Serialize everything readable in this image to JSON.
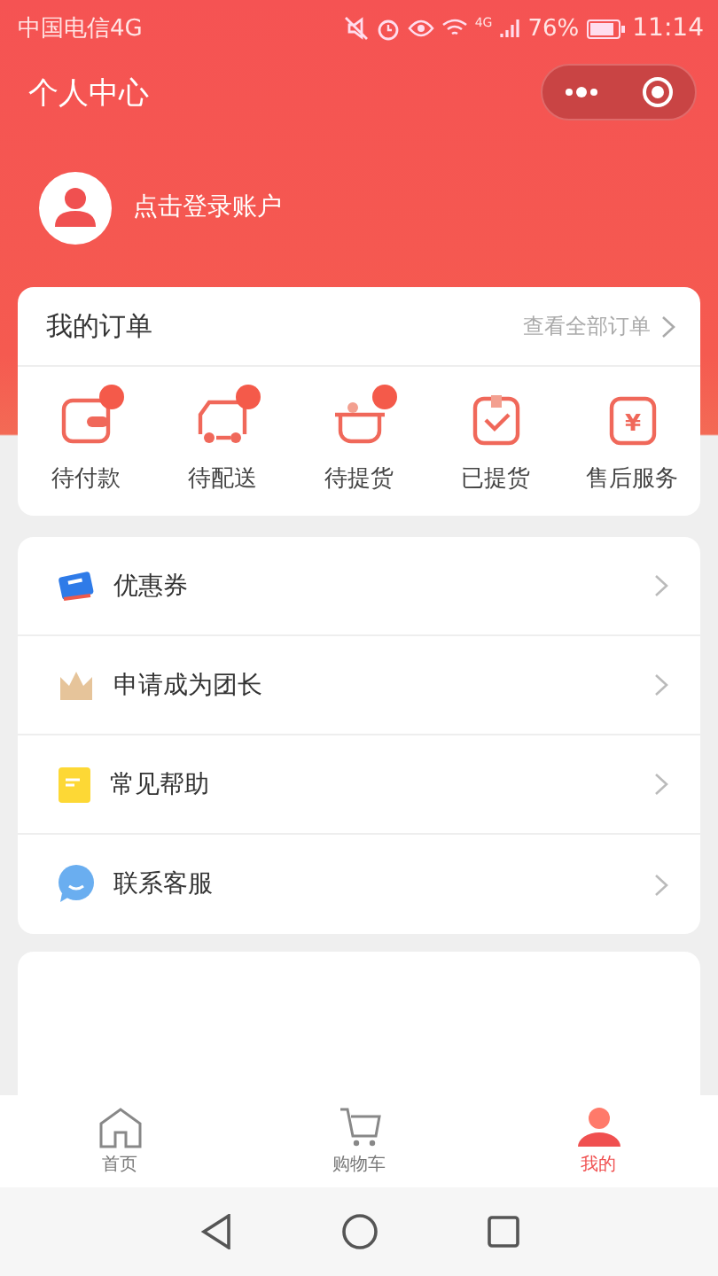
{
  "status_bar": {
    "carrier": "中国电信4G",
    "network": "4G",
    "battery": "76%",
    "time": "11:14"
  },
  "title_bar": {
    "title": "个人中心"
  },
  "profile": {
    "login_label": "点击登录账户"
  },
  "orders": {
    "title": "我的订单",
    "view_all": "查看全部订单",
    "items": [
      {
        "label": "待付款",
        "kind": "wallet",
        "badge": true
      },
      {
        "label": "待配送",
        "kind": "truck",
        "badge": true
      },
      {
        "label": "待提货",
        "kind": "basket",
        "badge": true
      },
      {
        "label": "已提货",
        "kind": "check",
        "badge": false
      },
      {
        "label": "售后服务",
        "kind": "refund",
        "badge": false,
        "icon_text": "¥"
      }
    ]
  },
  "menu": [
    {
      "label": "优惠券",
      "kind": "coupon"
    },
    {
      "label": "申请成为团长",
      "kind": "crown"
    },
    {
      "label": "常见帮助",
      "kind": "note"
    },
    {
      "label": "联系客服",
      "kind": "chat"
    }
  ],
  "tab_bar": [
    {
      "label": "首页",
      "kind": "home",
      "selected": false
    },
    {
      "label": "购物车",
      "kind": "cart",
      "selected": false
    },
    {
      "label": "我的",
      "kind": "user",
      "selected": true
    }
  ]
}
